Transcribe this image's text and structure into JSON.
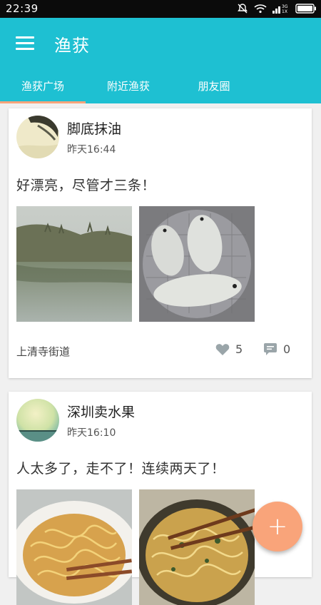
{
  "status_bar": {
    "time": "22:39",
    "icons": [
      "mute-icon",
      "wifi-icon",
      "signal-3g-1x-icon",
      "battery-icon"
    ]
  },
  "app_bar": {
    "title": "渔获",
    "menu_icon": "hamburger-menu-icon",
    "color": "#1ec0d2"
  },
  "tabs": [
    {
      "label": "渔获广场",
      "active": true
    },
    {
      "label": "附近渔获",
      "active": false
    },
    {
      "label": "朋友圈",
      "active": false
    }
  ],
  "accent_color": "#f9a47a",
  "posts": [
    {
      "author": "脚底抹油",
      "time": "昨天16:44",
      "content": "好漂亮，尽管才三条！",
      "photos": [
        "river-landscape-photo",
        "fish-catch-photo"
      ],
      "location": "上清寺街道",
      "likes": "5",
      "comments": "0"
    },
    {
      "author": "深圳卖水果",
      "time": "昨天16:10",
      "content": "人太多了，走不了！连续两天了！",
      "photos": [
        "noodle-bowl-photo",
        "noodle-pot-photo"
      ]
    }
  ],
  "fab": {
    "label": "+",
    "icon": "plus-icon"
  }
}
